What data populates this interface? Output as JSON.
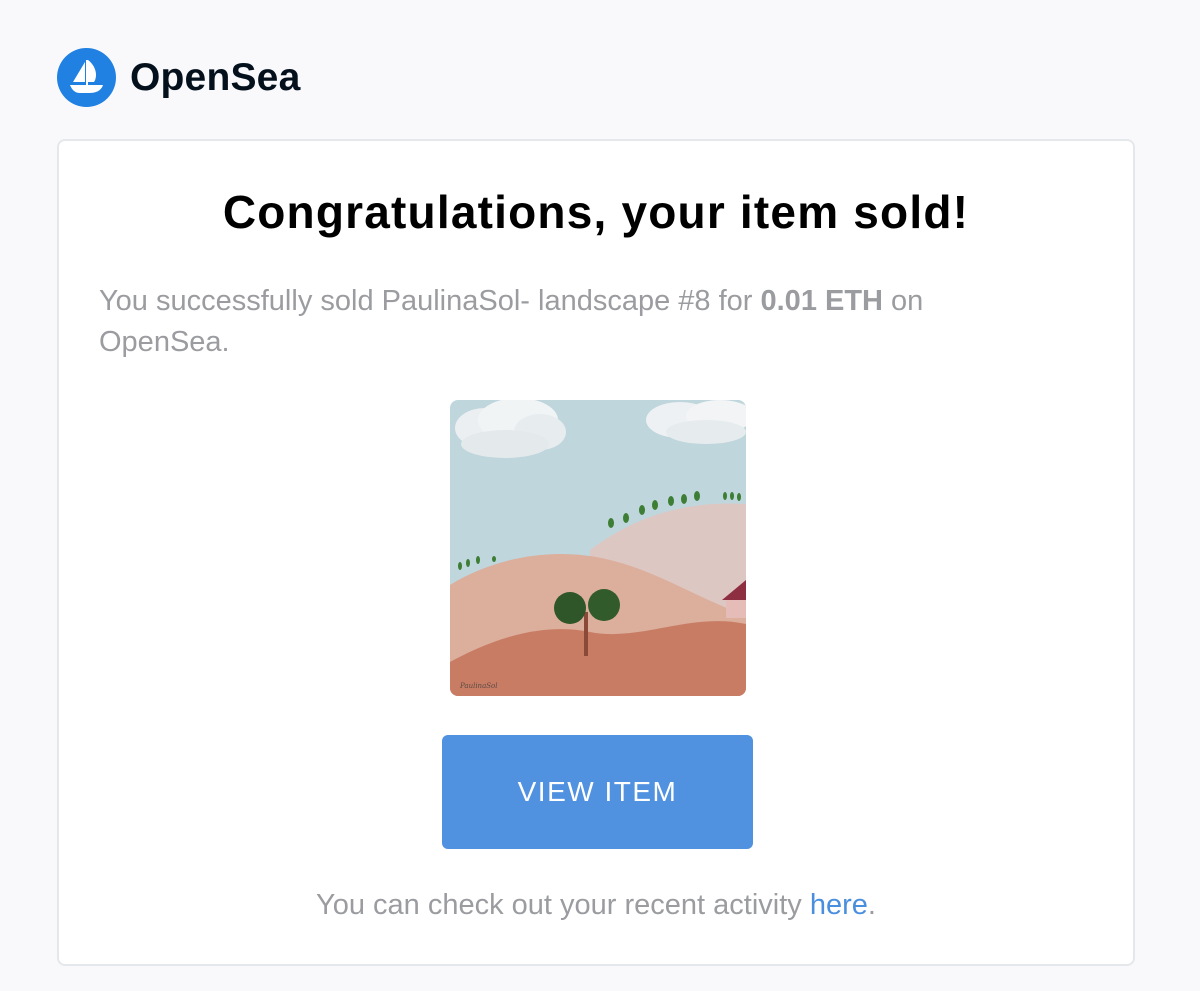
{
  "header": {
    "logo_icon": "sailboat-icon",
    "brand_name": "OpenSea"
  },
  "email": {
    "title": "Congratulations, your item sold!",
    "message_prefix": "You successfully sold PaulinaSol- landscape #8 for ",
    "price": "0.01 ETH",
    "message_suffix": " on OpenSea.",
    "image_signature": "PaulinaSol",
    "view_button_label": "VIEW ITEM",
    "footer_prefix": "You can check out your recent activity ",
    "footer_link_label": "here",
    "footer_suffix": "."
  },
  "colors": {
    "brand_blue": "#2081e2",
    "button_blue": "#5091e0",
    "link_blue": "#4a8fde",
    "muted_text": "#9a9ca0"
  }
}
